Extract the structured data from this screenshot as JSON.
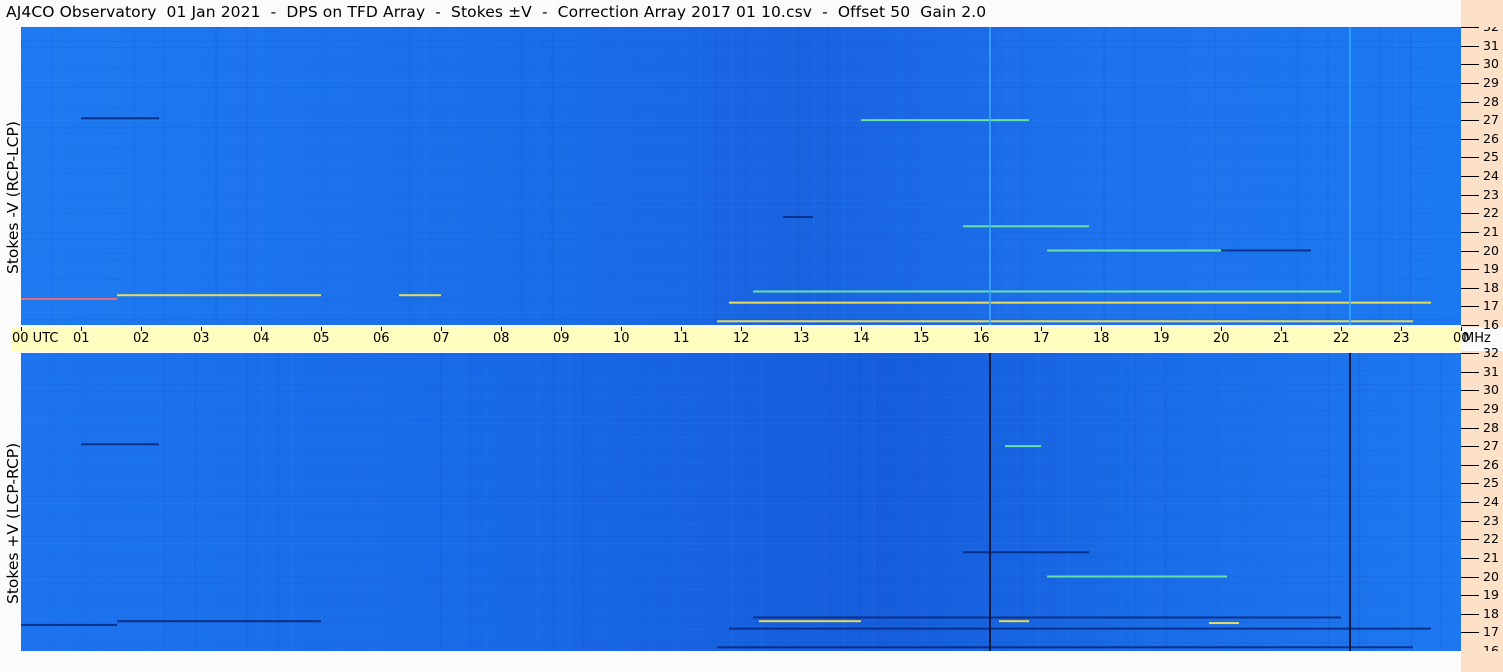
{
  "title": "AJ4CO Observatory  01 Jan 2021  -  DPS on TFD Array  -  Stokes ±V  -  Correction Array 2017 01 10.csv  -  Offset 50  Gain 2.0",
  "top_panel": {
    "ylabel": "Stokes -V (RCP-LCP)"
  },
  "bottom_panel": {
    "ylabel": "Stokes +V (LCP-RCP)"
  },
  "colors": {
    "background_blue": "#1a6fea",
    "dark_blue": "#0a2a80",
    "bright_green": "#6df0a0",
    "yellow": "#ffe84a",
    "time_bar": "#fffdbf",
    "freq_axis": "#fce1c8"
  },
  "chart_data": {
    "type": "heatmap",
    "x": [
      "00 UTC",
      "01",
      "02",
      "03",
      "04",
      "05",
      "06",
      "07",
      "08",
      "09",
      "10",
      "11",
      "12",
      "13",
      "14",
      "15",
      "16",
      "17",
      "18",
      "19",
      "20",
      "21",
      "22",
      "23",
      "00"
    ],
    "x_unit": "UTC",
    "y": [
      16,
      17,
      18,
      19,
      20,
      21,
      22,
      23,
      24,
      25,
      26,
      27,
      28,
      29,
      30,
      31,
      32
    ],
    "y_unit": "MHz",
    "markers_utc": [
      16.15,
      22.15
    ],
    "panels": [
      {
        "ylabel": "Stokes -V (RCP-LCP)",
        "features": [
          {
            "start": 0.0,
            "end": 1.6,
            "mhz": 17.4,
            "kind": "red"
          },
          {
            "start": 1.6,
            "end": 5.0,
            "mhz": 17.6,
            "kind": "yellow"
          },
          {
            "start": 6.3,
            "end": 7.0,
            "mhz": 17.6,
            "kind": "yellow"
          },
          {
            "start": 11.8,
            "end": 23.5,
            "mhz": 17.2,
            "kind": "yellow"
          },
          {
            "start": 12.2,
            "end": 22.0,
            "mhz": 17.8,
            "kind": "green"
          },
          {
            "start": 11.6,
            "end": 23.2,
            "mhz": 16.2,
            "kind": "yellow"
          },
          {
            "start": 15.7,
            "end": 17.8,
            "mhz": 21.3,
            "kind": "green"
          },
          {
            "start": 17.1,
            "end": 20.1,
            "mhz": 20.0,
            "kind": "green"
          },
          {
            "start": 20.0,
            "end": 21.5,
            "mhz": 20.0,
            "kind": "dark"
          },
          {
            "start": 1.0,
            "end": 2.3,
            "mhz": 27.1,
            "kind": "dark"
          },
          {
            "start": 14.0,
            "end": 16.8,
            "mhz": 27.0,
            "kind": "green"
          },
          {
            "start": 12.7,
            "end": 13.2,
            "mhz": 21.8,
            "kind": "dark"
          }
        ]
      },
      {
        "ylabel": "Stokes +V (LCP-RCP)",
        "features": [
          {
            "start": 0.0,
            "end": 1.6,
            "mhz": 17.4,
            "kind": "dark"
          },
          {
            "start": 1.6,
            "end": 5.0,
            "mhz": 17.6,
            "kind": "dark"
          },
          {
            "start": 11.8,
            "end": 23.5,
            "mhz": 17.2,
            "kind": "dark"
          },
          {
            "start": 12.2,
            "end": 22.0,
            "mhz": 17.8,
            "kind": "dark"
          },
          {
            "start": 11.6,
            "end": 23.2,
            "mhz": 16.2,
            "kind": "dark"
          },
          {
            "start": 12.3,
            "end": 14.0,
            "mhz": 17.6,
            "kind": "yellow"
          },
          {
            "start": 16.3,
            "end": 16.8,
            "mhz": 17.6,
            "kind": "yellow"
          },
          {
            "start": 19.8,
            "end": 20.3,
            "mhz": 17.5,
            "kind": "yellow"
          },
          {
            "start": 15.7,
            "end": 17.8,
            "mhz": 21.3,
            "kind": "dark"
          },
          {
            "start": 17.1,
            "end": 20.1,
            "mhz": 20.0,
            "kind": "green"
          },
          {
            "start": 1.0,
            "end": 2.3,
            "mhz": 27.1,
            "kind": "dark"
          },
          {
            "start": 16.4,
            "end": 17.0,
            "mhz": 27.0,
            "kind": "green"
          }
        ]
      }
    ]
  }
}
